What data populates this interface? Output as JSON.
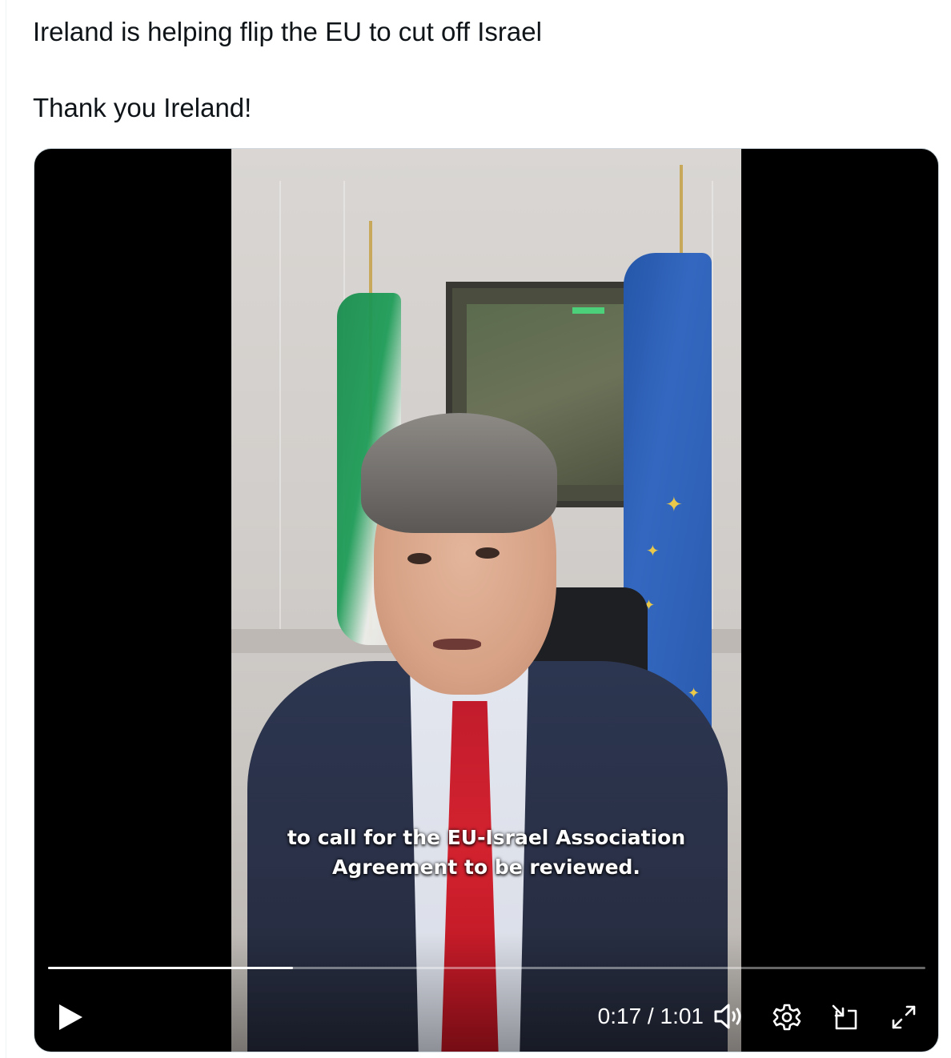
{
  "tweet": {
    "line1": "Ireland is helping flip the EU to cut off Israel",
    "line2": "Thank you Ireland!"
  },
  "video": {
    "caption_line1": "to call for the EU-Israel Association",
    "caption_line2": "Agreement to be reviewed.",
    "current_time": "0:17",
    "duration": "1:01",
    "time_display": "0:17 / 1:01",
    "progress_fraction": 0.279,
    "state": "paused",
    "icons": {
      "play": "play-icon",
      "volume": "volume-icon",
      "settings": "gear-icon",
      "pip": "picture-in-picture-icon",
      "fullscreen": "expand-icon"
    }
  }
}
